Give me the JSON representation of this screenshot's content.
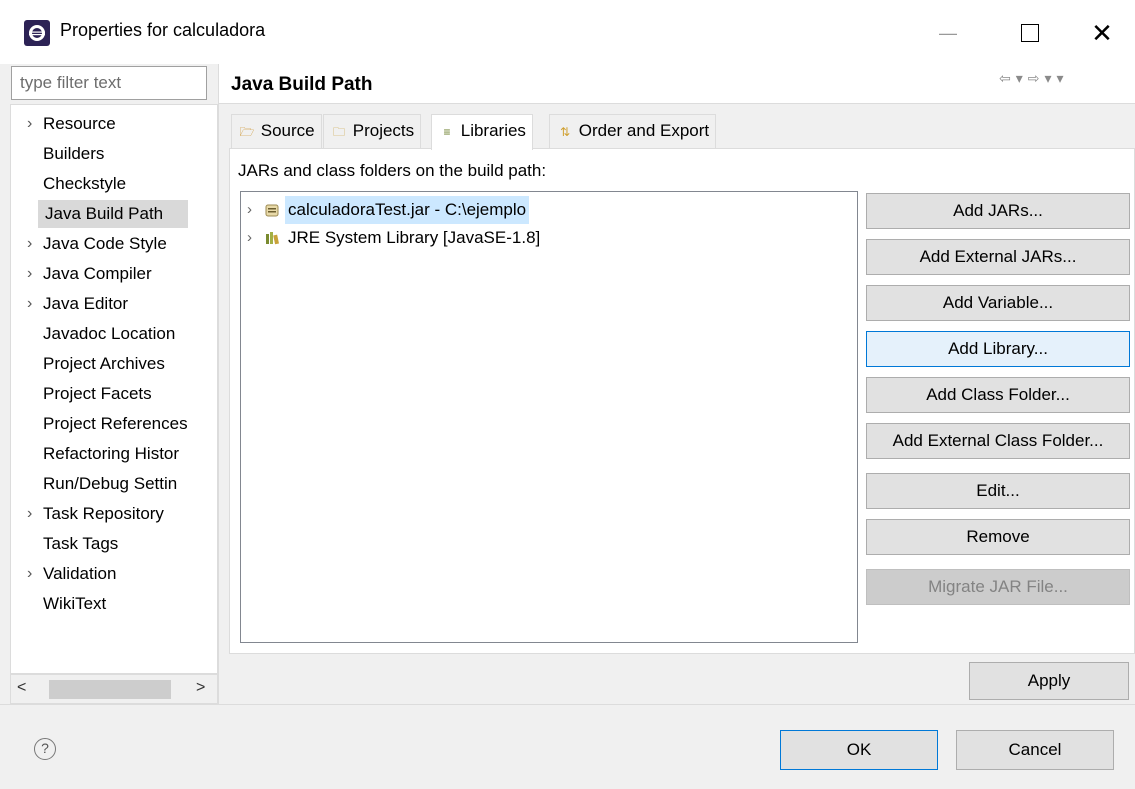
{
  "window": {
    "title": "Properties for calculadora"
  },
  "filter": {
    "placeholder": "type filter text"
  },
  "nav": {
    "items": [
      {
        "label": "Resource",
        "expandable": true
      },
      {
        "label": "Builders",
        "expandable": false
      },
      {
        "label": "Checkstyle",
        "expandable": false
      },
      {
        "label": "Java Build Path",
        "expandable": false,
        "selected": true
      },
      {
        "label": "Java Code Style",
        "expandable": true
      },
      {
        "label": "Java Compiler",
        "expandable": true
      },
      {
        "label": "Java Editor",
        "expandable": true
      },
      {
        "label": "Javadoc Location",
        "expandable": false
      },
      {
        "label": "Project Archives",
        "expandable": false
      },
      {
        "label": "Project Facets",
        "expandable": false
      },
      {
        "label": "Project References",
        "expandable": false
      },
      {
        "label": "Refactoring Histor",
        "expandable": false
      },
      {
        "label": "Run/Debug Settin",
        "expandable": false
      },
      {
        "label": "Task Repository",
        "expandable": true
      },
      {
        "label": "Task Tags",
        "expandable": false
      },
      {
        "label": "Validation",
        "expandable": true
      },
      {
        "label": "WikiText",
        "expandable": false
      }
    ]
  },
  "page": {
    "title": "Java Build Path",
    "tabs": [
      {
        "label": "Source",
        "icon": "source-folder-icon"
      },
      {
        "label": "Projects",
        "icon": "projects-icon"
      },
      {
        "label": "Libraries",
        "icon": "libraries-icon",
        "active": true
      },
      {
        "label": "Order and Export",
        "icon": "order-export-icon"
      }
    ],
    "build_path_label": "JARs and class folders on the build path:",
    "tree": [
      {
        "label": "calculadoraTest.jar - C:\\ejemplo",
        "icon": "jar-icon",
        "selected": true
      },
      {
        "label": "JRE System Library [JavaSE-1.8]",
        "icon": "library-icon",
        "selected": false
      }
    ],
    "buttons": [
      {
        "label": "Add JARs...",
        "state": "normal"
      },
      {
        "label": "Add External JARs...",
        "state": "normal"
      },
      {
        "label": "Add Variable...",
        "state": "normal"
      },
      {
        "label": "Add Library...",
        "state": "hover"
      },
      {
        "label": "Add Class Folder...",
        "state": "normal"
      },
      {
        "label": "Add External Class Folder...",
        "state": "normal"
      },
      {
        "label": "Edit...",
        "state": "normal"
      },
      {
        "label": "Remove",
        "state": "normal"
      },
      {
        "label": "Migrate JAR File...",
        "state": "disabled"
      }
    ],
    "apply_label": "Apply"
  },
  "footer": {
    "ok_label": "OK",
    "cancel_label": "Cancel"
  },
  "colors": {
    "selection": "#cce8ff",
    "accent": "#0078d7",
    "nav_selected": "#d9d9d9"
  }
}
